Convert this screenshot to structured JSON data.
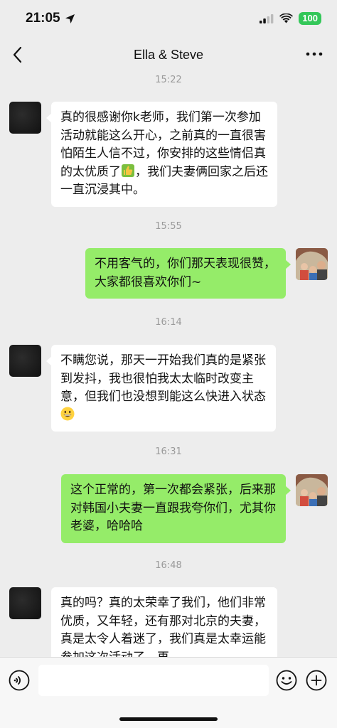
{
  "status_bar": {
    "time": "21:05",
    "battery": "100"
  },
  "nav": {
    "title": "Ella & Steve"
  },
  "timestamps": [
    "15:22",
    "15:55",
    "16:14",
    "16:31",
    "16:48"
  ],
  "messages": [
    {
      "side": "left",
      "text": "真的很感谢你k老师，我们第一次参加活动就能这么开心，之前真的一直很害怕陌生人信不过，你安排的这些情侣真的太优质了",
      "emoji": "thumbs-up",
      "text_after": "，我们夫妻俩回家之后还一直沉浸其中。"
    },
    {
      "side": "right",
      "text": "不用客气的，你们那天表现很赞，大家都很喜欢你们~"
    },
    {
      "side": "left",
      "text": "不瞒您说，那天一开始我们真的是紧张到发抖，我也很怕我太太临时改变主意，但我们也没想到能这么快进入状态",
      "emoji": "grinning-face"
    },
    {
      "side": "right",
      "text": "这个正常的，第一次都会紧张，后来那对韩国小夫妻一直跟我夸你们，尤其你老婆，哈哈哈"
    },
    {
      "side": "left",
      "text": "真的吗？真的太荣幸了我们，他们非常优质，又年轻，还有那对北京的夫妻，真是太令人着迷了，我们真是太幸运能参加这次活动了，再"
    }
  ],
  "input": {
    "placeholder": ""
  },
  "colors": {
    "background": "#ededed",
    "bubble_self": "#95ec69",
    "bubble_other": "#ffffff",
    "battery": "#34c759"
  },
  "icons": [
    "location-arrow-icon",
    "signal-icon",
    "wifi-icon",
    "back-chevron-icon",
    "more-icon",
    "voice-icon",
    "emoji-icon",
    "plus-icon",
    "thumbs-up-icon",
    "grinning-face-icon"
  ]
}
